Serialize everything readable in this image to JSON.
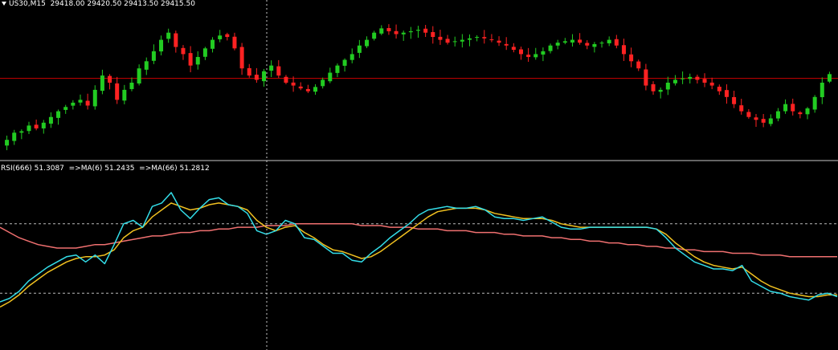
{
  "header": {
    "symbol": "US30,M15",
    "ohlc": "29418.00 29420.50 29413.50 29415.50"
  },
  "indicator": {
    "label": "RSI(666) 51.3087  =>MA(6) 51.2435  =>MA(66) 51.2812"
  },
  "colors": {
    "background": "#000000",
    "bull": "#22cc22",
    "bear": "#ff2222",
    "price_hline": "#cc0000",
    "rsi": "#33dde8",
    "ma_fast": "#f0c020",
    "ma_slow": "#f07070",
    "crosshair": "#c8c8c8",
    "level_lines": "#bbbbbb",
    "separator": "#c8c8c8"
  },
  "chart_data": [
    {
      "type": "candlestick",
      "symbol": "US30",
      "timeframe": "M15",
      "title": "US30,M15",
      "last_ohlc": [
        29418.0,
        29420.5,
        29413.5,
        29415.5
      ],
      "note": "relative price shape (0-100 scale, no price axis visible)",
      "horizontal_line_level": 53,
      "ylim": [
        0,
        100
      ],
      "closes": [
        10,
        15,
        16,
        20,
        18,
        22,
        26,
        30,
        33,
        36,
        38,
        34,
        45,
        55,
        50,
        38,
        45,
        50,
        60,
        65,
        72,
        80,
        85,
        75,
        70,
        62,
        68,
        74,
        80,
        83,
        82,
        74,
        60,
        55,
        52,
        58,
        62,
        55,
        50,
        48,
        46,
        44,
        47,
        52,
        57,
        62,
        66,
        70,
        76,
        80,
        85,
        88,
        86,
        84,
        85,
        86,
        87,
        85,
        82,
        80,
        78,
        79,
        80,
        81,
        82,
        81,
        80,
        78,
        76,
        73,
        70,
        68,
        70,
        72,
        76,
        78,
        79,
        80,
        78,
        76,
        77,
        78,
        80,
        76,
        70,
        65,
        60,
        48,
        44,
        45,
        50,
        52,
        53,
        54,
        52,
        50,
        48,
        44,
        40,
        35,
        30,
        26,
        24,
        22,
        25,
        30,
        35,
        30,
        28,
        32,
        40,
        50,
        56
      ]
    },
    {
      "type": "line",
      "title": "RSI(666) 51.3087  =>MA(6) 51.2435  =>MA(66) 51.2812",
      "ylim": [
        0,
        100
      ],
      "levels": [
        70,
        30
      ],
      "series": [
        {
          "name": "RSI(666)",
          "values": [
            25,
            27,
            31,
            37,
            41,
            45,
            48,
            51,
            52,
            48,
            52,
            47,
            58,
            70,
            72,
            68,
            80,
            82,
            88,
            78,
            73,
            79,
            84,
            85,
            81,
            80,
            76,
            66,
            64,
            66,
            72,
            70,
            62,
            61,
            57,
            53,
            53,
            49,
            48,
            53,
            57,
            62,
            66,
            70,
            75,
            78,
            79,
            80,
            79,
            79,
            80,
            78,
            74,
            73,
            73,
            72,
            73,
            74,
            71,
            68,
            67,
            67,
            68,
            68,
            68,
            68,
            68,
            68,
            68,
            67,
            62,
            56,
            52,
            48,
            46,
            44,
            44,
            43,
            46,
            37,
            34,
            31,
            30,
            28,
            27,
            26,
            29,
            30,
            28
          ]
        },
        {
          "name": "MA(6)",
          "values": [
            22,
            25,
            29,
            34,
            38,
            42,
            45,
            48,
            50,
            51,
            51,
            52,
            55,
            62,
            66,
            68,
            74,
            78,
            82,
            80,
            78,
            79,
            81,
            82,
            81,
            80,
            78,
            72,
            68,
            66,
            68,
            69,
            65,
            62,
            58,
            55,
            54,
            52,
            50,
            51,
            54,
            58,
            62,
            66,
            70,
            74,
            77,
            78,
            79,
            79,
            79,
            78,
            76,
            75,
            74,
            73,
            73,
            73,
            72,
            70,
            69,
            68,
            68,
            68,
            68,
            68,
            68,
            68,
            68,
            67,
            64,
            59,
            55,
            51,
            48,
            46,
            45,
            44,
            45,
            41,
            37,
            34,
            32,
            30,
            29,
            28,
            28,
            29,
            29
          ]
        },
        {
          "name": "MA(66)",
          "values": [
            68,
            65,
            62,
            60,
            58,
            57,
            56,
            56,
            56,
            57,
            58,
            58,
            59,
            60,
            61,
            62,
            63,
            63,
            64,
            65,
            65,
            66,
            66,
            67,
            67,
            68,
            68,
            68,
            69,
            69,
            69,
            70,
            70,
            70,
            70,
            70,
            70,
            70,
            69,
            69,
            69,
            68,
            68,
            68,
            67,
            67,
            67,
            66,
            66,
            66,
            65,
            65,
            65,
            64,
            64,
            63,
            63,
            63,
            62,
            62,
            61,
            61,
            60,
            60,
            59,
            59,
            58,
            58,
            57,
            57,
            56,
            56,
            55,
            55,
            54,
            54,
            54,
            53,
            53,
            53,
            52,
            52,
            52,
            51,
            51,
            51,
            51,
            51,
            51
          ]
        }
      ]
    }
  ]
}
